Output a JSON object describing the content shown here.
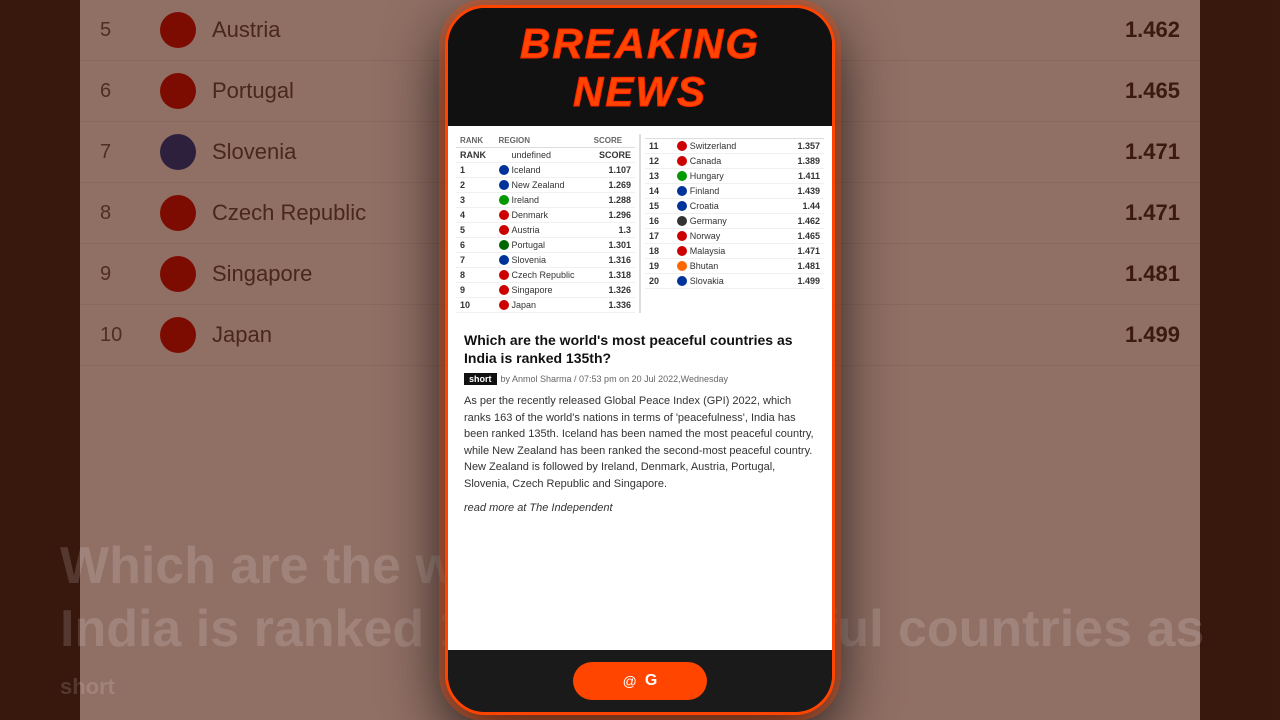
{
  "background": {
    "rows": [
      {
        "rank": "5",
        "country": "Austria",
        "score": "1.462",
        "flagColor": "#cc0000"
      },
      {
        "rank": "6",
        "country": "Portugal",
        "score": "1.465",
        "flagColor": "#006600"
      },
      {
        "rank": "7",
        "country": "Slovenia",
        "score": "1.471",
        "flagColor": "#003399"
      },
      {
        "rank": "8",
        "country": "Czech Republic",
        "score": "1.471",
        "flagColor": "#cc0000"
      },
      {
        "rank": "9",
        "country": "Singapore",
        "score": "1.481",
        "flagColor": "#cc0000"
      },
      {
        "rank": "10",
        "country": "Japan",
        "score": "1.499",
        "flagColor": "#cc0000"
      }
    ],
    "big_text_left": "Which are the w",
    "big_text_right": "ful countries as",
    "big_text_left2": "India is ranked 1",
    "short_label": "short"
  },
  "modal": {
    "breaking_news_label": "BREAKING NEWS",
    "rankings": {
      "left_col": [
        {
          "rank": "RANK",
          "region": "REGION",
          "score": "SCORE",
          "header": true
        },
        {
          "rank": "1",
          "country": "Iceland",
          "score": "1.107",
          "flagColor": "#003399"
        },
        {
          "rank": "2",
          "country": "New Zealand",
          "score": "1.269",
          "flagColor": "#003399"
        },
        {
          "rank": "3",
          "country": "Ireland",
          "score": "1.288",
          "flagColor": "#009900"
        },
        {
          "rank": "4",
          "country": "Denmark",
          "score": "1.296",
          "flagColor": "#cc0000"
        },
        {
          "rank": "5",
          "country": "Austria",
          "score": "1.3",
          "flagColor": "#cc0000"
        },
        {
          "rank": "6",
          "country": "Portugal",
          "score": "1.301",
          "flagColor": "#006600"
        },
        {
          "rank": "7",
          "country": "Slovenia",
          "score": "1.316",
          "flagColor": "#003399"
        },
        {
          "rank": "8",
          "country": "Czech Republic",
          "score": "1.318",
          "flagColor": "#cc0000"
        },
        {
          "rank": "9",
          "country": "Singapore",
          "score": "1.326",
          "flagColor": "#cc0000"
        },
        {
          "rank": "10",
          "country": "Japan",
          "score": "1.336",
          "flagColor": "#cc0000"
        }
      ],
      "right_col": [
        {
          "rank": "11",
          "country": "Switzerland",
          "score": "1.357",
          "flagColor": "#cc0000"
        },
        {
          "rank": "12",
          "country": "Canada",
          "score": "1.389",
          "flagColor": "#cc0000"
        },
        {
          "rank": "13",
          "country": "Hungary",
          "score": "1.411",
          "flagColor": "#009900"
        },
        {
          "rank": "14",
          "country": "Finland",
          "score": "1.439",
          "flagColor": "#003399"
        },
        {
          "rank": "15",
          "country": "Croatia",
          "score": "1.44",
          "flagColor": "#003399"
        },
        {
          "rank": "16",
          "country": "Germany",
          "score": "1.462",
          "flagColor": "#333"
        },
        {
          "rank": "17",
          "country": "Norway",
          "score": "1.465",
          "flagColor": "#cc0000"
        },
        {
          "rank": "18",
          "country": "Malaysia",
          "score": "1.471",
          "flagColor": "#cc0000"
        },
        {
          "rank": "19",
          "country": "Bhutan",
          "score": "1.481",
          "flagColor": "#ff6600"
        },
        {
          "rank": "20",
          "country": "Slovakia",
          "score": "1.499",
          "flagColor": "#003399"
        }
      ]
    },
    "article": {
      "title": "Which are the world's most peaceful countries as India is ranked 135th?",
      "meta_short": "short",
      "meta_by": "by Anmol Sharma / 07:53 pm on 20 Jul 2022,Wednesday",
      "body": "As per the recently released Global Peace Index (GPI) 2022, which ranks 163 of the world's nations in terms of 'peacefulness', India has been ranked 135th. Iceland has been named the most peaceful country, while New Zealand has been ranked the second-most peaceful country. New Zealand is followed by Ireland, Denmark, Austria, Portugal, Slovenia, Czech Republic and Singapore.",
      "read_more": "read more at The Independent"
    },
    "bottom": {
      "icon": "@",
      "label": "G"
    }
  }
}
